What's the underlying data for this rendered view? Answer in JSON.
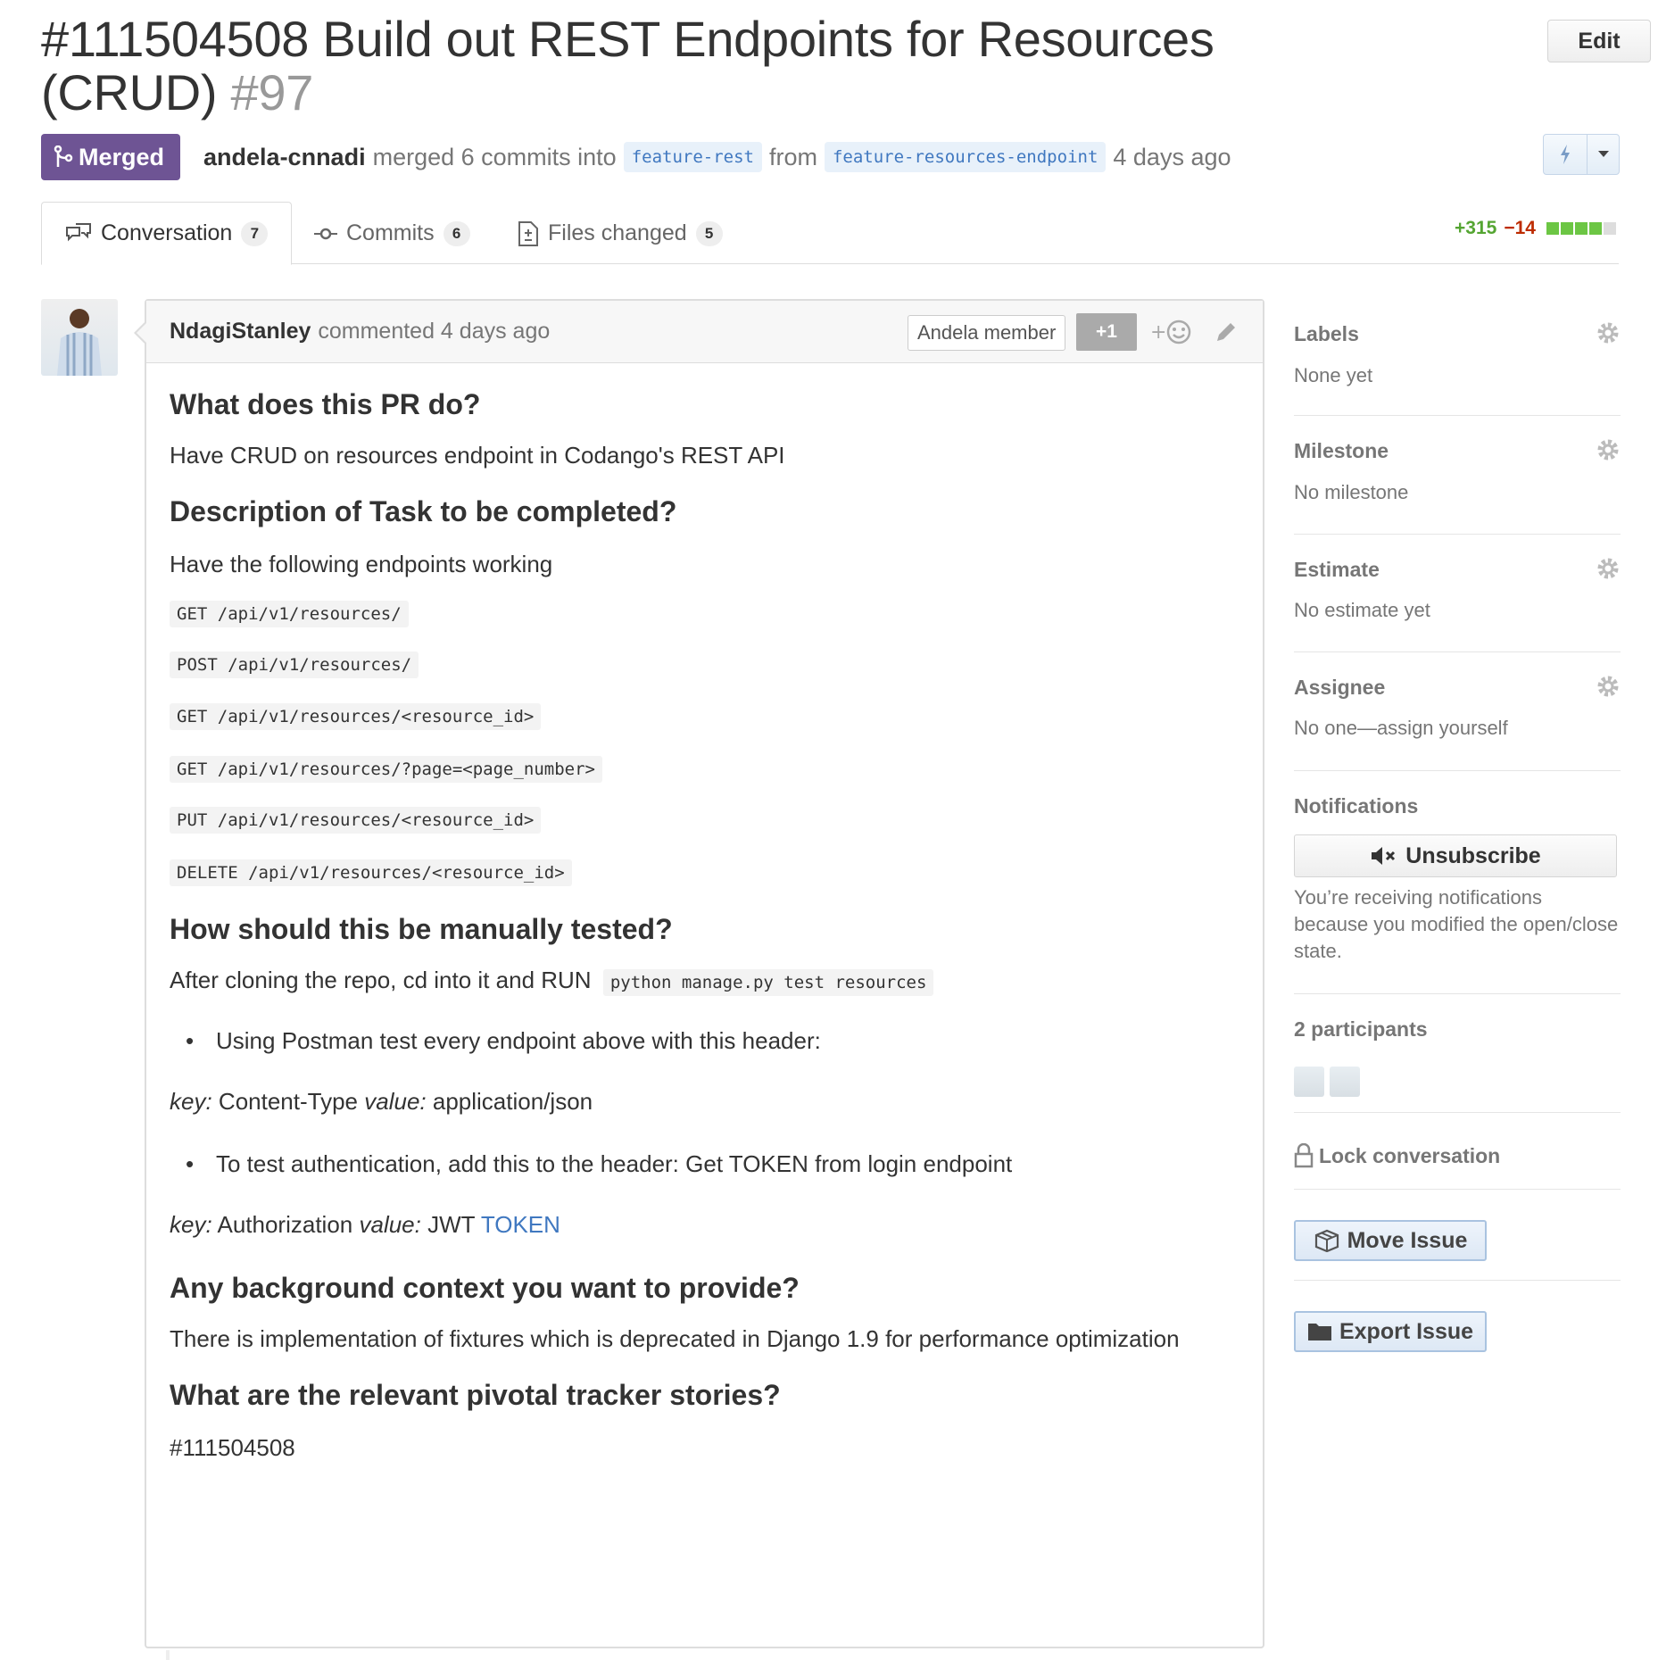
{
  "header": {
    "title": "#111504508 Build out REST Endpoints for Resources (CRUD)",
    "number": "#97",
    "edit_label": "Edit"
  },
  "meta": {
    "state": "Merged",
    "author": "andela-cnnadi",
    "action": "merged 6 commits into",
    "base_branch": "feature-rest",
    "from": "from",
    "head_branch": "feature-resources-endpoint",
    "time": "4 days ago"
  },
  "tabs": [
    {
      "label": "Conversation",
      "count": "7",
      "icon": "comment-discussion-icon"
    },
    {
      "label": "Commits",
      "count": "6",
      "icon": "commit-icon"
    },
    {
      "label": "Files changed",
      "count": "5",
      "icon": "diff-icon"
    }
  ],
  "diffstat": {
    "additions": "+315",
    "deletions": "−14"
  },
  "comment": {
    "author": "NdagiStanley",
    "action": "commented 4 days ago",
    "member_label": "Andela member",
    "plus_one": "+1",
    "body": {
      "h_what": "What does this PR do?",
      "p_what": "Have CRUD on resources endpoint in Codango's REST API",
      "h_desc": "Description of Task to be completed?",
      "p_desc": "Have the following endpoints working",
      "endpoints": [
        "GET /api/v1/resources/",
        "POST /api/v1/resources/",
        "GET /api/v1/resources/<resource_id>",
        "GET /api/v1/resources/?page=<page_number>",
        "PUT /api/v1/resources/<resource_id>",
        "DELETE /api/v1/resources/<resource_id>"
      ],
      "h_test": "How should this be manually tested?",
      "p_test": "After cloning the repo, cd into it and RUN",
      "test_cmd": "python manage.py test resources",
      "li_postman": "Using Postman test every endpoint above with this header:",
      "key1_label": "key:",
      "key1_val": "Content-Type",
      "val1_label": "value:",
      "val1_val": "application/json",
      "li_auth": "To test authentication, add this to the header: Get TOKEN from login endpoint",
      "key2_label": "key:",
      "key2_val": "Authorization",
      "val2_label": "value:",
      "val2_val": "JWT",
      "val2_link": "TOKEN",
      "h_bg": "Any background context you want to provide?",
      "p_bg": "There is implementation of fixtures which is deprecated in Django 1.9 for performance optimization",
      "h_stories": "What are the relevant pivotal tracker stories?",
      "p_stories": "#111504508"
    }
  },
  "sidebar": {
    "labels": {
      "title": "Labels",
      "value": "None yet"
    },
    "milestone": {
      "title": "Milestone",
      "value": "No milestone"
    },
    "estimate": {
      "title": "Estimate",
      "value": "No estimate yet"
    },
    "assignee": {
      "title": "Assignee",
      "value": "No one—assign yourself"
    },
    "notifications": {
      "title": "Notifications",
      "button": "Unsubscribe",
      "text": "You’re receiving notifications because you modified the open/close state."
    },
    "participants": {
      "title": "2 participants"
    },
    "lock": "Lock conversation",
    "move": "Move Issue",
    "export": "Export Issue"
  },
  "colors": {
    "merged": "#6e5494",
    "link": "#4078c0",
    "additions": "#55a532",
    "deletions": "#bd2c00"
  }
}
